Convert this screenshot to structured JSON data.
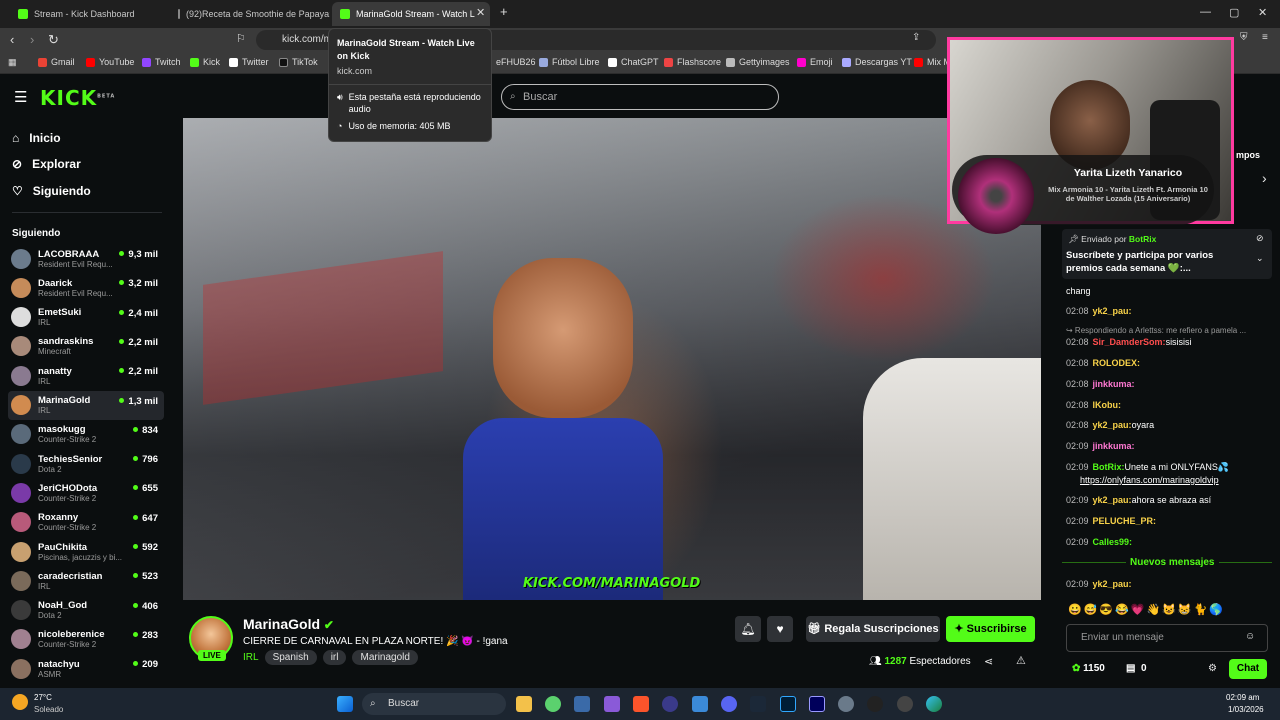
{
  "browser": {
    "tabs": [
      {
        "title": "Stream - Kick Dashboard",
        "active": false
      },
      {
        "title": "(92)Receta de Smoothie de Papaya: C",
        "active": false
      },
      {
        "title": "MarinaGold Stream - Watch L",
        "active": true
      }
    ],
    "url": "kick.com/m",
    "bookmarks": [
      "Gmail",
      "YouTube",
      "Twitch",
      "Kick",
      "Twitter",
      "TikTok",
      "eFHUB26",
      "Fútbol Libre",
      "ChatGPT",
      "Flashscore",
      "Gettyimages",
      "Emoji",
      "Descargas YT",
      "Mix M"
    ],
    "tooltip": {
      "title": "MarinaGold Stream - Watch Live on Kick",
      "domain": "kick.com",
      "audio": "Esta pestaña está reproduciendo audio",
      "memory": "Uso de memoria: 405 MB"
    }
  },
  "header": {
    "logo": "KICK",
    "logo_beta": "BETA",
    "search_placeholder": "Buscar"
  },
  "nav": {
    "home": "Inicio",
    "explore": "Explorar",
    "following": "Siguiendo"
  },
  "following": {
    "heading": "Siguiendo",
    "items": [
      {
        "name": "LACOBRAAA",
        "category": "Resident Evil Requ...",
        "viewers": "9,3 mil",
        "color": "#6b7b8c"
      },
      {
        "name": "Daarick",
        "category": "Resident Evil Requ...",
        "viewers": "3,2 mil",
        "color": "#c58b5a"
      },
      {
        "name": "EmetSuki",
        "category": "IRL",
        "viewers": "2,4 mil",
        "color": "#dddddd"
      },
      {
        "name": "sandraskins",
        "category": "Minecraft",
        "viewers": "2,2 mil",
        "color": "#a88a7a"
      },
      {
        "name": "nanatty",
        "category": "IRL",
        "viewers": "2,2 mil",
        "color": "#8a7a90"
      },
      {
        "name": "MarinaGold",
        "category": "IRL",
        "viewers": "1,3 mil",
        "color": "#d18b4f"
      },
      {
        "name": "masokugg",
        "category": "Counter-Strike 2",
        "viewers": "834",
        "color": "#5a6a7a"
      },
      {
        "name": "TechiesSenior",
        "category": "Dota 2",
        "viewers": "796",
        "color": "#2a3a4a"
      },
      {
        "name": "JeriCHODota",
        "category": "Counter-Strike 2",
        "viewers": "655",
        "color": "#7a3aa8"
      },
      {
        "name": "Roxanny",
        "category": "Counter-Strike 2",
        "viewers": "647",
        "color": "#b85a7a"
      },
      {
        "name": "PauChikita",
        "category": "Piscinas, jacuzzis y bi...",
        "viewers": "592",
        "color": "#c8a070"
      },
      {
        "name": "caradecristian",
        "category": "IRL",
        "viewers": "523",
        "color": "#7a6a5a"
      },
      {
        "name": "NoaH_God",
        "category": "Dota 2",
        "viewers": "406",
        "color": "#3a3a3a"
      },
      {
        "name": "nicoleberenice",
        "category": "Counter-Strike 2",
        "viewers": "283",
        "color": "#a08090"
      },
      {
        "name": "natachyu",
        "category": "ASMR",
        "viewers": "209",
        "color": "#8a7060"
      }
    ]
  },
  "video": {
    "watermark": "KICK.COM/MARINAGOLD"
  },
  "stream": {
    "channel": "MarinaGold",
    "live": "LIVE",
    "title": "CIERRE DE CARNAVAL EN PLAZA NORTE! 🎉 😈 - !gana",
    "category": "IRL",
    "tags": [
      "Spanish",
      "irl",
      "Marinagold"
    ],
    "gift_label": "Regala Suscripciones",
    "subscribe_label": "Suscribirse",
    "viewers": "1287",
    "viewers_label": "Espectadores"
  },
  "overlay": {
    "song_artist": "Yarita Lizeth Yanarico",
    "song_title": "Mix Armonia 10 - Yarita Lizeth Ft. Armonia 10 de Walther Lozada (15 Aniversario)",
    "side_text": "mpos"
  },
  "chat": {
    "pinned_by": "Enviado por",
    "pinned_user": "BotRix",
    "pinned_text": "Suscríbete y participa por varios premios cada semana 💚:...",
    "messages": [
      {
        "time": "",
        "user": "",
        "text": "chang",
        "cls": ""
      },
      {
        "time": "02:08",
        "user": "yk2_pau:",
        "text": "",
        "cls": "u-yellow"
      },
      {
        "time": "",
        "user": "",
        "text": "↪ Respondiendo a Arlettss: me refiero a pamela ...",
        "cls": ""
      },
      {
        "time": "02:08",
        "user": "Sir_DamderSom:",
        "text": "sisisisi",
        "cls": "u-red"
      },
      {
        "time": "02:08",
        "user": "ROLODEX:",
        "text": "",
        "cls": "u-yellow"
      },
      {
        "time": "02:08",
        "user": "jinkkuma:",
        "text": "",
        "cls": "u-pink"
      },
      {
        "time": "02:08",
        "user": "lKobu:",
        "text": "",
        "cls": "u-yellow"
      },
      {
        "time": "02:08",
        "user": "yk2_pau:",
        "text": "oyara",
        "cls": "u-yellow"
      },
      {
        "time": "02:09",
        "user": "jinkkuma:",
        "text": "",
        "cls": "u-pink"
      },
      {
        "time": "02:09",
        "user": "BotRix:",
        "text": "Unete a mi ONLYFANS💦",
        "cls": "u-green"
      },
      {
        "time": "",
        "user": "",
        "text": "https://onlyfans.com/marinagoldvip",
        "cls": ""
      },
      {
        "time": "02:09",
        "user": "yk2_pau:",
        "text": "ahora se abraza así",
        "cls": "u-yellow"
      },
      {
        "time": "02:09",
        "user": "PELUCHE_PR:",
        "text": "",
        "cls": "u-yellow"
      },
      {
        "time": "02:09",
        "user": "Calles99:",
        "text": "",
        "cls": "u-green"
      }
    ],
    "new_messages": "Nuevos mensajes",
    "last": {
      "time": "02:09",
      "user": "yk2_pau:"
    },
    "input_placeholder": "Enviar un mensaje",
    "points": "1150",
    "count": "0",
    "chat_button": "Chat"
  },
  "taskbar": {
    "weather_temp": "27°C",
    "weather_desc": "Soleado",
    "search": "Buscar",
    "time": "02:09 am",
    "date": "1/03/2026"
  }
}
